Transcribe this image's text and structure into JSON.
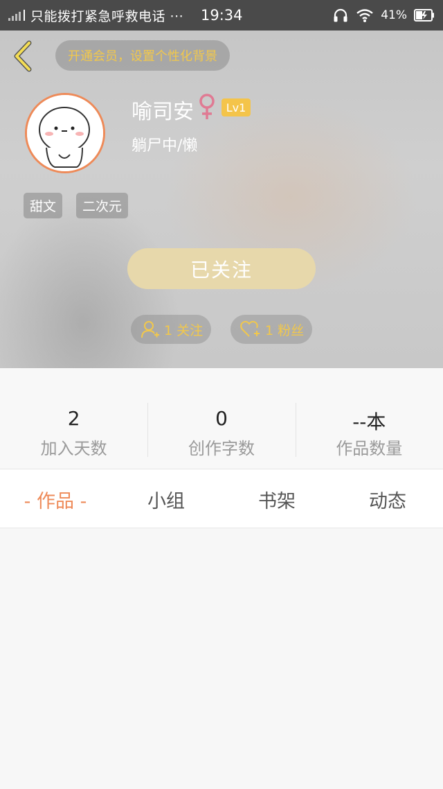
{
  "status_bar": {
    "carrier": "只能拨打紧急呼救电话 ···",
    "time": "19:34",
    "battery": "41%"
  },
  "header": {
    "vip_banner": "开通会员，设置个性化背景",
    "user_name": "喻司安",
    "level": "Lv1",
    "status": "躺尸中/懒",
    "tags": [
      "甜文",
      "二次元"
    ],
    "follow_button": "已关注",
    "following": "1 关注",
    "fans": "1 粉丝"
  },
  "stats": [
    {
      "value": "2",
      "label": "加入天数"
    },
    {
      "value": "0",
      "label": "创作字数"
    },
    {
      "value": "--本",
      "label": "作品数量"
    }
  ],
  "tabs": [
    "- 作品 -",
    "小组",
    "书架",
    "动态"
  ],
  "colors": {
    "accent": "#ee8a58",
    "gold": "#f2c84b",
    "follow_button": "#e7d8ab",
    "gender": "#e07a93"
  }
}
